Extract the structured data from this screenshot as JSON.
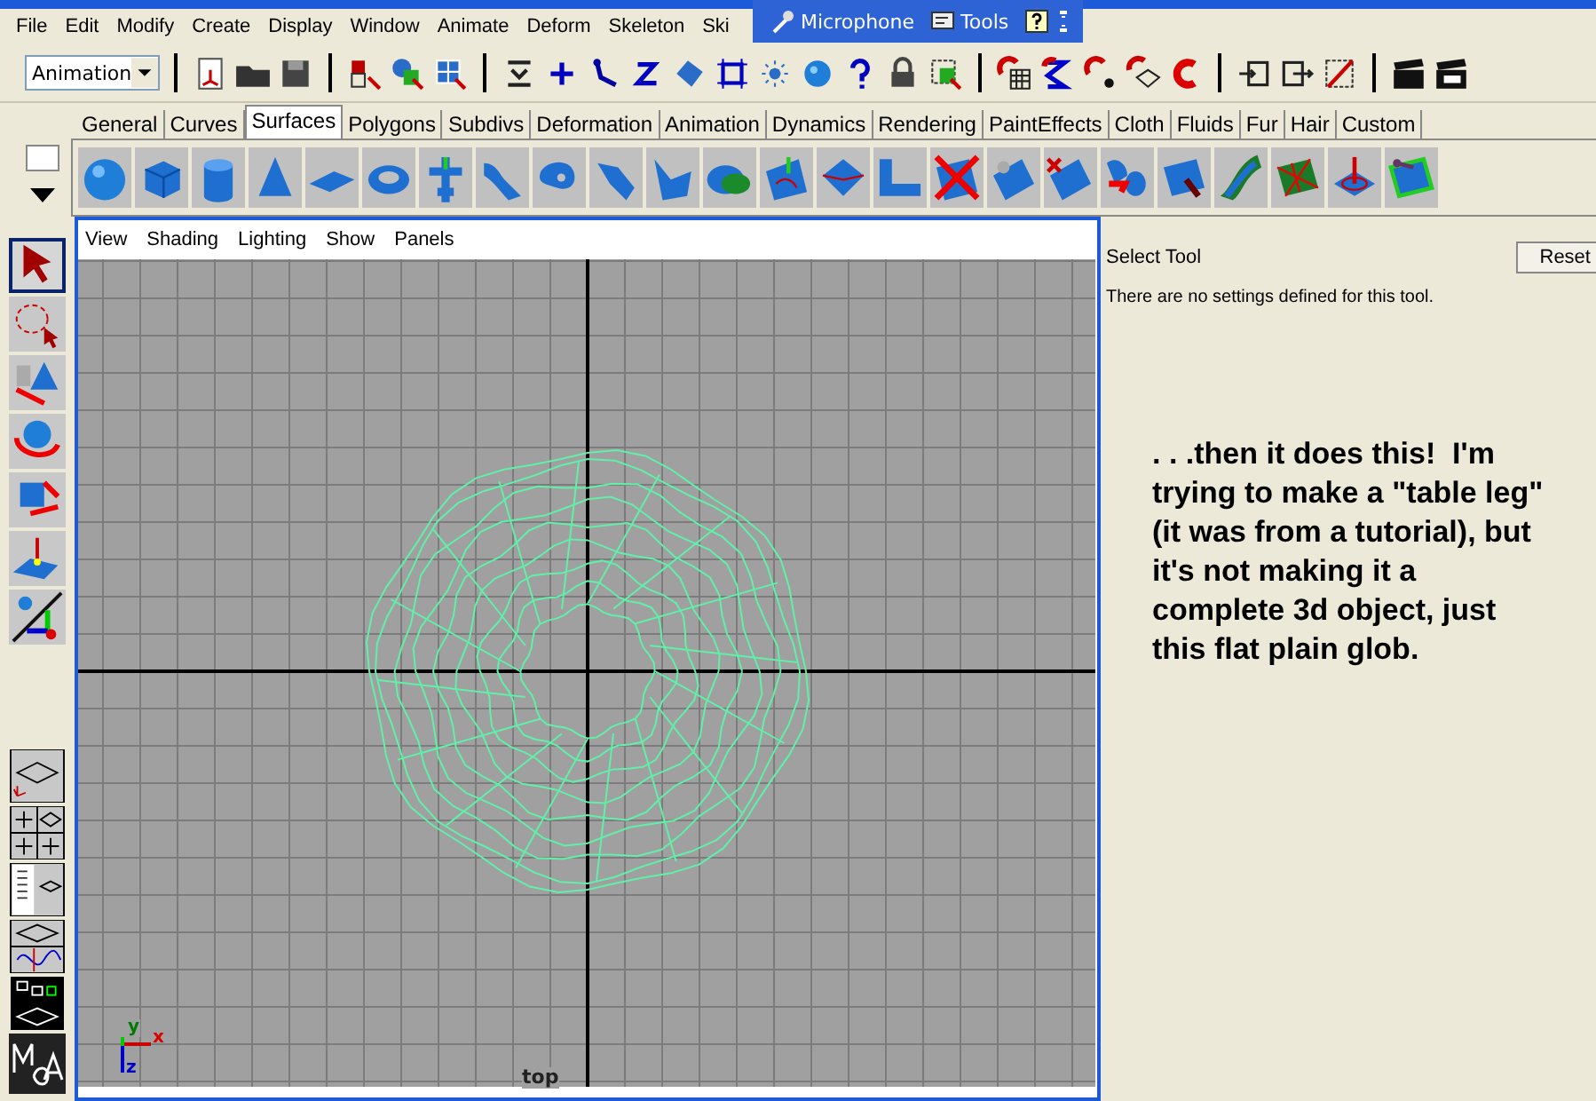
{
  "menubar": {
    "items": [
      "File",
      "Edit",
      "Modify",
      "Create",
      "Display",
      "Window",
      "Animate",
      "Deform",
      "Skeleton",
      "Ski"
    ]
  },
  "language_bar": {
    "items": [
      "Microphone",
      "Tools"
    ]
  },
  "toolbar": {
    "mode_dropdown": {
      "value": "Animation"
    }
  },
  "shelf": {
    "tabs": [
      {
        "label": "General",
        "selected": false
      },
      {
        "label": "Curves",
        "selected": false
      },
      {
        "label": "Surfaces",
        "selected": true
      },
      {
        "label": "Polygons",
        "selected": false
      },
      {
        "label": "Subdivs",
        "selected": false
      },
      {
        "label": "Deformation",
        "selected": false
      },
      {
        "label": "Animation",
        "selected": false
      },
      {
        "label": "Dynamics",
        "selected": false
      },
      {
        "label": "Rendering",
        "selected": false
      },
      {
        "label": "PaintEffects",
        "selected": false
      },
      {
        "label": "Cloth",
        "selected": false
      },
      {
        "label": "Fluids",
        "selected": false
      },
      {
        "label": "Fur",
        "selected": false
      },
      {
        "label": "Hair",
        "selected": false
      },
      {
        "label": "Custom",
        "selected": false
      }
    ]
  },
  "toolbox": {
    "tools": [
      {
        "selected": true
      },
      {
        "selected": false
      },
      {
        "selected": false
      },
      {
        "selected": false
      },
      {
        "selected": false
      },
      {
        "selected": false
      },
      {
        "selected": false
      }
    ]
  },
  "viewport": {
    "menu": [
      "View",
      "Shading",
      "Lighting",
      "Show",
      "Panels"
    ],
    "camera_label": "top",
    "axis_labels": [
      "y",
      "x",
      "z"
    ]
  },
  "tool_settings": {
    "title": "Select Tool",
    "reset_button": "Reset",
    "message": "There are no settings defined for this tool."
  },
  "annotation": ". . .then it does this!  I'm trying to make a \"table leg\" (it was from a tutorial), but it's not making it a complete 3d object, just this flat plain glob."
}
